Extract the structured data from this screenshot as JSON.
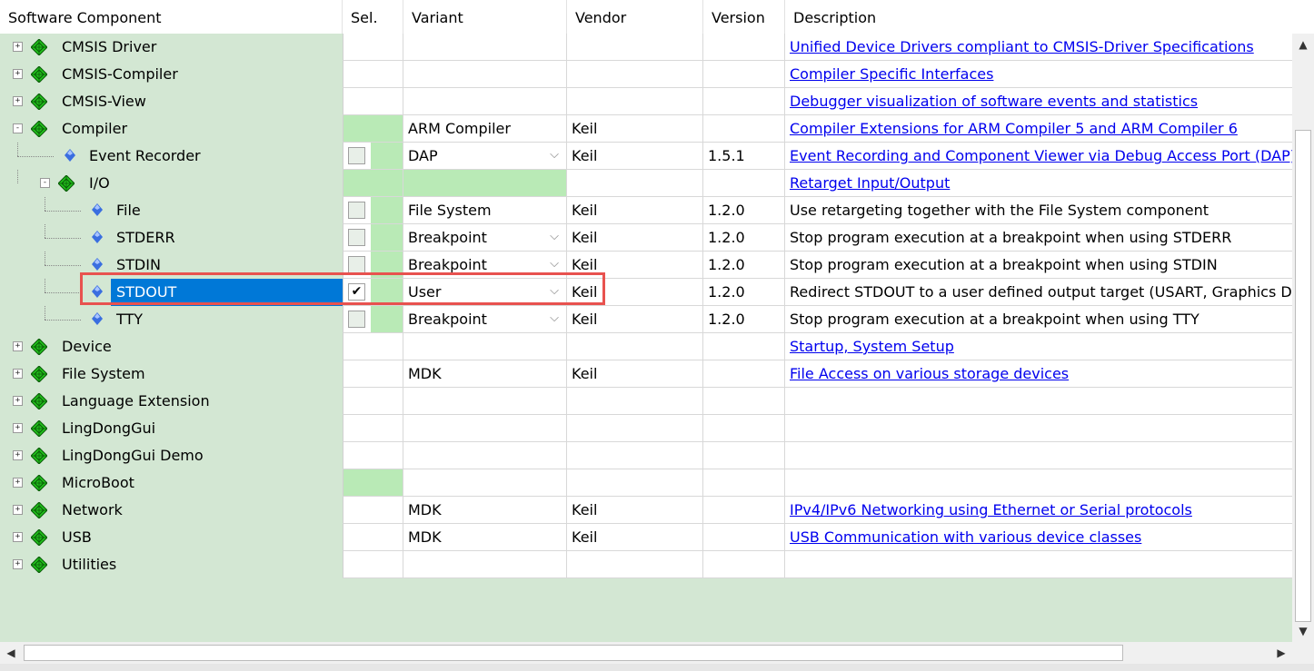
{
  "headers": {
    "component": "Software Component",
    "sel": "Sel.",
    "variant": "Variant",
    "vendor": "Vendor",
    "version": "Version",
    "description": "Description"
  },
  "rows": [
    {
      "name": "CMSIS Driver",
      "level": 0,
      "expander": "+",
      "icon": "green-diamond",
      "sel": "",
      "variant": "",
      "vendor": "",
      "version": "",
      "desc": "Unified Device Drivers compliant to CMSIS-Driver Specifications",
      "desc_link": true
    },
    {
      "name": "CMSIS-Compiler",
      "level": 0,
      "expander": "+",
      "icon": "green-diamond",
      "sel": "",
      "variant": "",
      "vendor": "",
      "version": "",
      "desc": "Compiler Specific Interfaces",
      "desc_link": true
    },
    {
      "name": "CMSIS-View",
      "level": 0,
      "expander": "+",
      "icon": "green-diamond",
      "sel": "",
      "variant": "",
      "vendor": "",
      "version": "",
      "desc": "Debugger visualization of software events and statistics",
      "desc_link": true
    },
    {
      "name": "Compiler",
      "level": 0,
      "expander": "-",
      "icon": "green-diamond",
      "sel": "green",
      "variant": "ARM Compiler",
      "vendor": "Keil",
      "version": "",
      "desc": "Compiler Extensions for ARM Compiler 5 and ARM Compiler 6",
      "desc_link": true
    },
    {
      "name": "Event Recorder",
      "level": 1,
      "expander": "",
      "icon": "blue-diamond",
      "sel": "checkbox-empty",
      "variant": "DAP",
      "dropdown": true,
      "vendor": "Keil",
      "version": "1.5.1",
      "desc": "Event Recording and Component Viewer via Debug Access Port (DAP)",
      "desc_link": true
    },
    {
      "name": "I/O",
      "level": 1,
      "expander": "-",
      "icon": "green-diamond",
      "sel": "green",
      "variant": "",
      "variant_green": true,
      "vendor": "",
      "version": "",
      "desc": "Retarget Input/Output",
      "desc_link": true
    },
    {
      "name": "File",
      "level": 2,
      "expander": "",
      "icon": "blue-diamond",
      "sel": "checkbox-empty",
      "variant": "File System",
      "vendor": "Keil",
      "version": "1.2.0",
      "desc": "Use retargeting together with the File System component",
      "desc_link": false
    },
    {
      "name": "STDERR",
      "level": 2,
      "expander": "",
      "icon": "blue-diamond",
      "sel": "checkbox-empty",
      "variant": "Breakpoint",
      "dropdown": true,
      "vendor": "Keil",
      "version": "1.2.0",
      "desc": "Stop program execution at a breakpoint when using STDERR",
      "desc_link": false
    },
    {
      "name": "STDIN",
      "level": 2,
      "expander": "",
      "icon": "blue-diamond",
      "sel": "checkbox-empty",
      "variant": "Breakpoint",
      "dropdown": true,
      "vendor": "Keil",
      "version": "1.2.0",
      "desc": "Stop program execution at a breakpoint when using STDIN",
      "desc_link": false
    },
    {
      "name": "STDOUT",
      "level": 2,
      "expander": "",
      "icon": "blue-diamond",
      "sel": "checkbox-checked",
      "selected": true,
      "variant": "User",
      "dropdown": true,
      "vendor": "Keil",
      "version": "1.2.0",
      "desc": "Redirect STDOUT to a user defined output target (USART, Graphics Display or other)",
      "desc_link": false
    },
    {
      "name": "TTY",
      "level": 2,
      "expander": "",
      "icon": "blue-diamond",
      "sel": "checkbox-empty",
      "variant": "Breakpoint",
      "dropdown": true,
      "vendor": "Keil",
      "version": "1.2.0",
      "desc": "Stop program execution at a breakpoint when using TTY",
      "desc_link": false
    },
    {
      "name": "Device",
      "level": 0,
      "expander": "+",
      "icon": "green-diamond",
      "sel": "",
      "variant": "",
      "vendor": "",
      "version": "",
      "desc": "Startup, System Setup",
      "desc_link": true
    },
    {
      "name": "File System",
      "level": 0,
      "expander": "+",
      "icon": "green-diamond",
      "sel": "",
      "variant": "MDK",
      "vendor": "Keil",
      "version": "",
      "desc": "File Access on various storage devices",
      "desc_link": true
    },
    {
      "name": "Language Extension",
      "level": 0,
      "expander": "+",
      "icon": "green-diamond",
      "sel": "",
      "variant": "",
      "vendor": "",
      "version": "",
      "desc": "",
      "desc_link": false
    },
    {
      "name": "LingDongGui",
      "level": 0,
      "expander": "+",
      "icon": "green-diamond",
      "sel": "",
      "variant": "",
      "vendor": "",
      "version": "",
      "desc": "",
      "desc_link": false
    },
    {
      "name": "LingDongGui Demo",
      "level": 0,
      "expander": "+",
      "icon": "green-diamond",
      "sel": "",
      "variant": "",
      "vendor": "",
      "version": "",
      "desc": "",
      "desc_link": false
    },
    {
      "name": "MicroBoot",
      "level": 0,
      "expander": "+",
      "icon": "green-diamond",
      "sel": "green",
      "variant": "",
      "vendor": "",
      "version": "",
      "desc": "",
      "desc_link": false
    },
    {
      "name": "Network",
      "level": 0,
      "expander": "+",
      "icon": "green-diamond",
      "sel": "",
      "variant": "MDK",
      "vendor": "Keil",
      "version": "",
      "desc": "IPv4/IPv6 Networking using Ethernet or Serial protocols",
      "desc_link": true
    },
    {
      "name": "USB",
      "level": 0,
      "expander": "+",
      "icon": "green-diamond",
      "sel": "",
      "variant": "MDK",
      "vendor": "Keil",
      "version": "",
      "desc": "USB Communication with various device classes",
      "desc_link": true
    },
    {
      "name": "Utilities",
      "level": 0,
      "expander": "+",
      "icon": "green-diamond",
      "sel": "",
      "variant": "",
      "vendor": "",
      "version": "",
      "desc": "",
      "desc_link": false
    }
  ],
  "scroll": {
    "up": "▲",
    "down": "▼",
    "left": "◀",
    "right": "▶"
  },
  "colors": {
    "highlight": "#e8524f",
    "selection": "#0078d7",
    "link": "#0000ee",
    "tree_bg": "#d3e7d3",
    "sel_green": "#b9eab6"
  }
}
